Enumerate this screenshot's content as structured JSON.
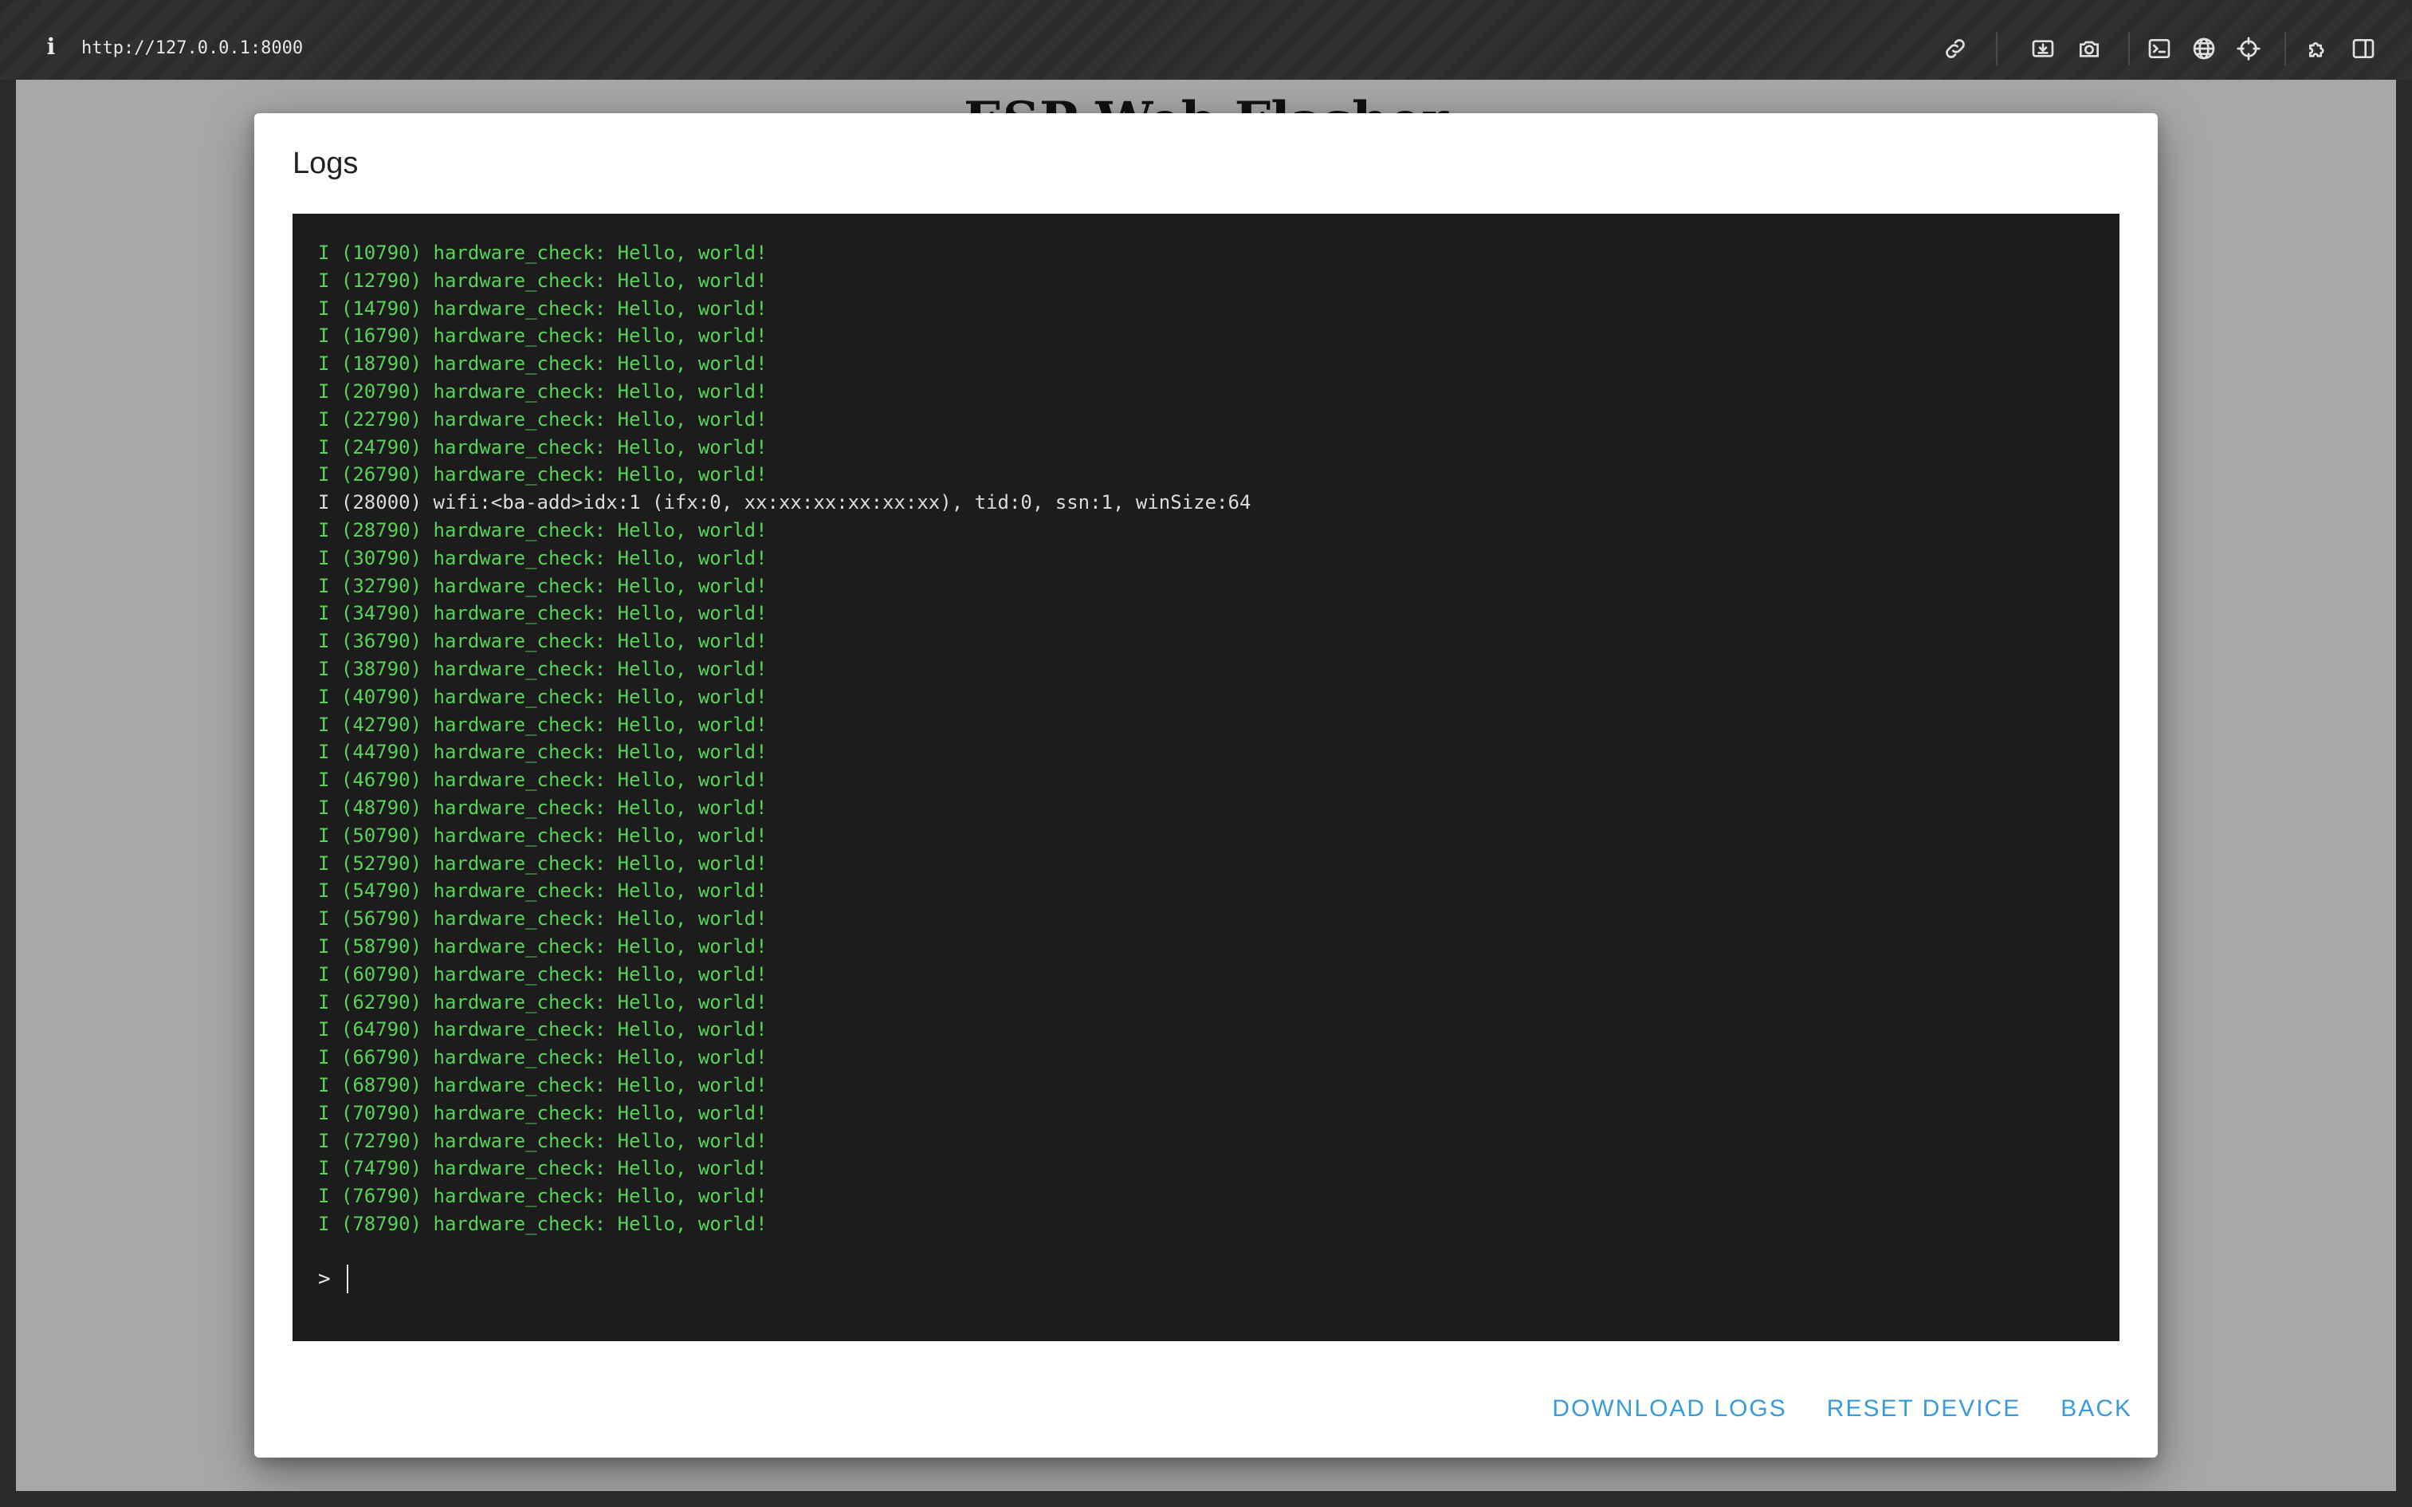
{
  "browser": {
    "url": "http://127.0.0.1:8000",
    "info_glyph": "i"
  },
  "page": {
    "heading": "ESP Web Flasher"
  },
  "dialog": {
    "title": "Logs",
    "log_lines": [
      {
        "text": "I (10790) hardware_check: Hello, world!",
        "level": "info"
      },
      {
        "text": "I (12790) hardware_check: Hello, world!",
        "level": "info"
      },
      {
        "text": "I (14790) hardware_check: Hello, world!",
        "level": "info"
      },
      {
        "text": "I (16790) hardware_check: Hello, world!",
        "level": "info"
      },
      {
        "text": "I (18790) hardware_check: Hello, world!",
        "level": "info"
      },
      {
        "text": "I (20790) hardware_check: Hello, world!",
        "level": "info"
      },
      {
        "text": "I (22790) hardware_check: Hello, world!",
        "level": "info"
      },
      {
        "text": "I (24790) hardware_check: Hello, world!",
        "level": "info"
      },
      {
        "text": "I (26790) hardware_check: Hello, world!",
        "level": "info"
      },
      {
        "text": "I (28000) wifi:<ba-add>idx:1 (ifx:0, xx:xx:xx:xx:xx:xx), tid:0, ssn:1, winSize:64",
        "level": "plain"
      },
      {
        "text": "I (28790) hardware_check: Hello, world!",
        "level": "info"
      },
      {
        "text": "I (30790) hardware_check: Hello, world!",
        "level": "info"
      },
      {
        "text": "I (32790) hardware_check: Hello, world!",
        "level": "info"
      },
      {
        "text": "I (34790) hardware_check: Hello, world!",
        "level": "info"
      },
      {
        "text": "I (36790) hardware_check: Hello, world!",
        "level": "info"
      },
      {
        "text": "I (38790) hardware_check: Hello, world!",
        "level": "info"
      },
      {
        "text": "I (40790) hardware_check: Hello, world!",
        "level": "info"
      },
      {
        "text": "I (42790) hardware_check: Hello, world!",
        "level": "info"
      },
      {
        "text": "I (44790) hardware_check: Hello, world!",
        "level": "info"
      },
      {
        "text": "I (46790) hardware_check: Hello, world!",
        "level": "info"
      },
      {
        "text": "I (48790) hardware_check: Hello, world!",
        "level": "info"
      },
      {
        "text": "I (50790) hardware_check: Hello, world!",
        "level": "info"
      },
      {
        "text": "I (52790) hardware_check: Hello, world!",
        "level": "info"
      },
      {
        "text": "I (54790) hardware_check: Hello, world!",
        "level": "info"
      },
      {
        "text": "I (56790) hardware_check: Hello, world!",
        "level": "info"
      },
      {
        "text": "I (58790) hardware_check: Hello, world!",
        "level": "info"
      },
      {
        "text": "I (60790) hardware_check: Hello, world!",
        "level": "info"
      },
      {
        "text": "I (62790) hardware_check: Hello, world!",
        "level": "info"
      },
      {
        "text": "I (64790) hardware_check: Hello, world!",
        "level": "info"
      },
      {
        "text": "I (66790) hardware_check: Hello, world!",
        "level": "info"
      },
      {
        "text": "I (68790) hardware_check: Hello, world!",
        "level": "info"
      },
      {
        "text": "I (70790) hardware_check: Hello, world!",
        "level": "info"
      },
      {
        "text": "I (72790) hardware_check: Hello, world!",
        "level": "info"
      },
      {
        "text": "I (74790) hardware_check: Hello, world!",
        "level": "info"
      },
      {
        "text": "I (76790) hardware_check: Hello, world!",
        "level": "info"
      },
      {
        "text": "I (78790) hardware_check: Hello, world!",
        "level": "info"
      }
    ],
    "prompt_symbol": ">",
    "prompt_value": "",
    "actions": {
      "download_label": "Download Logs",
      "reset_label": "Reset Device",
      "back_label": "Back"
    }
  },
  "colors": {
    "log_info": "#57d457",
    "log_plain": "#dcdcdc",
    "terminal_bg": "#1c1c1c",
    "action_blue": "#3a9bdc",
    "backdrop": "#a7a7a7"
  },
  "icons": {
    "toolbar": [
      "link-icon",
      "download-screenshot-icon",
      "camera-icon",
      "terminal-icon",
      "globe-icon",
      "crosshair-icon",
      "extension-icon",
      "split-view-icon"
    ]
  }
}
